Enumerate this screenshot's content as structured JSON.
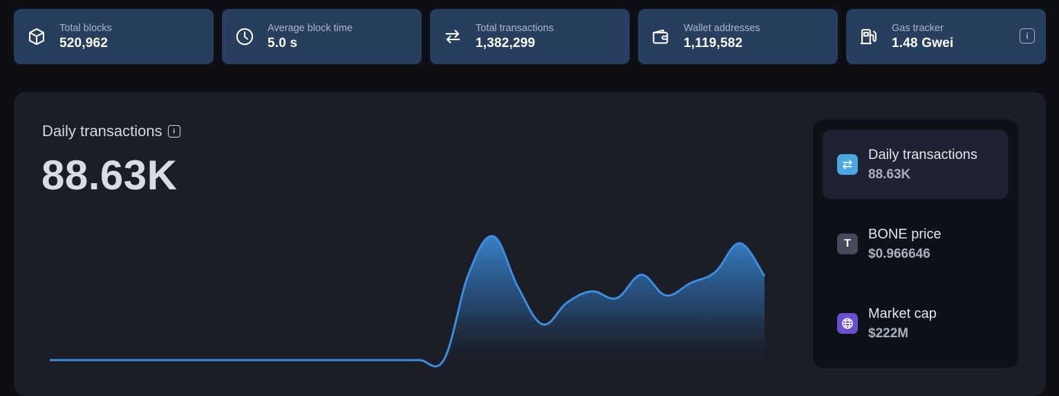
{
  "stats": [
    {
      "label": "Total blocks",
      "value": "520,962",
      "icon": "cube-icon"
    },
    {
      "label": "Average block time",
      "value": "5.0 s",
      "icon": "clock-icon"
    },
    {
      "label": "Total transactions",
      "value": "1,382,299",
      "icon": "transfer-arrows-icon"
    },
    {
      "label": "Wallet addresses",
      "value": "1,119,582",
      "icon": "wallet-icon"
    },
    {
      "label": "Gas tracker",
      "value": "1.48 Gwei",
      "icon": "gas-pump-icon"
    }
  ],
  "chart_panel": {
    "title": "Daily transactions",
    "value": "88.63K"
  },
  "side_items": [
    {
      "label": "Daily transactions",
      "value": "88.63K",
      "icon": "transfer-arrows-icon",
      "icon_color": "#4aa8de"
    },
    {
      "label": "BONE price",
      "value": "$0.966646",
      "icon_text": "T",
      "icon_color": "#464b5c"
    },
    {
      "label": "Market cap",
      "value": "$222M",
      "icon": "globe-icon",
      "icon_color": "#6a4fcf"
    }
  ],
  "colors": {
    "card_bg": "#283e5e",
    "panel_bg": "#1b1d27",
    "line": "#3b8ee0",
    "area_top": "#3a86d1"
  },
  "chart_data": {
    "type": "area",
    "title": "",
    "xlabel": "",
    "ylabel": "",
    "x": [
      0,
      1,
      2,
      3,
      4,
      5,
      6,
      7,
      8,
      9,
      10,
      11,
      12,
      13,
      14,
      15,
      16,
      17,
      18,
      19,
      20,
      21,
      22,
      23,
      24,
      25,
      26,
      27,
      28,
      29
    ],
    "series": [
      {
        "name": "",
        "values": [
          2,
          2,
          2,
          2,
          2,
          2,
          2,
          2,
          2,
          2,
          2,
          2,
          2,
          2,
          2,
          2,
          2.5,
          65,
          92,
          55,
          28,
          44,
          52,
          47,
          64,
          49,
          58,
          66,
          87,
          63
        ]
      }
    ],
    "ylim": [
      0,
      100
    ],
    "grid": false,
    "legend": "none"
  }
}
